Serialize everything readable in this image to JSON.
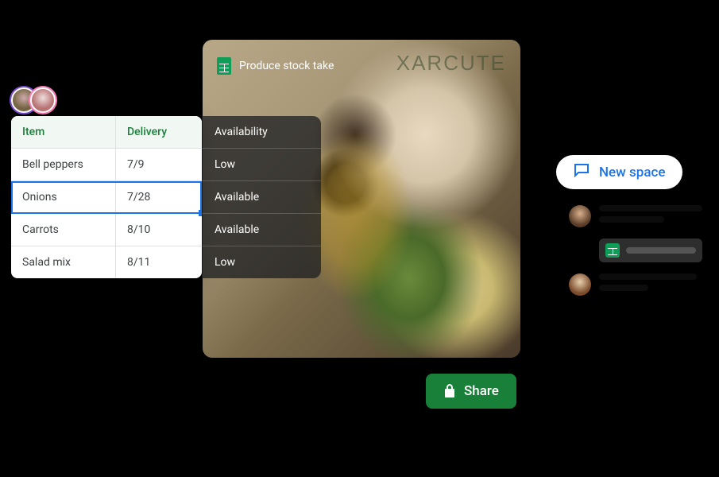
{
  "doc": {
    "title": "Produce stock take"
  },
  "photo": {
    "sign_text": "XARCUTE"
  },
  "sheet": {
    "headers": {
      "item": "Item",
      "delivery": "Delivery"
    },
    "rows": [
      {
        "item": "Bell peppers",
        "delivery": "7/9",
        "selected": false
      },
      {
        "item": "Onions",
        "delivery": "7/28",
        "selected": true
      },
      {
        "item": "Carrots",
        "delivery": "8/10",
        "selected": false
      },
      {
        "item": "Salad mix",
        "delivery": "8/11",
        "selected": false
      }
    ]
  },
  "availability": {
    "header": "Availability",
    "rows": [
      "Low",
      "Available",
      "Available",
      "Low"
    ]
  },
  "share": {
    "label": "Share"
  },
  "newspace": {
    "label": "New space"
  },
  "icons": {
    "sheets": "sheets-icon",
    "lock": "lock-icon",
    "chat": "chat-icon"
  },
  "colors": {
    "brand_green": "#188038",
    "brand_blue": "#1a73e8",
    "sheets_green": "#0f9d58"
  }
}
